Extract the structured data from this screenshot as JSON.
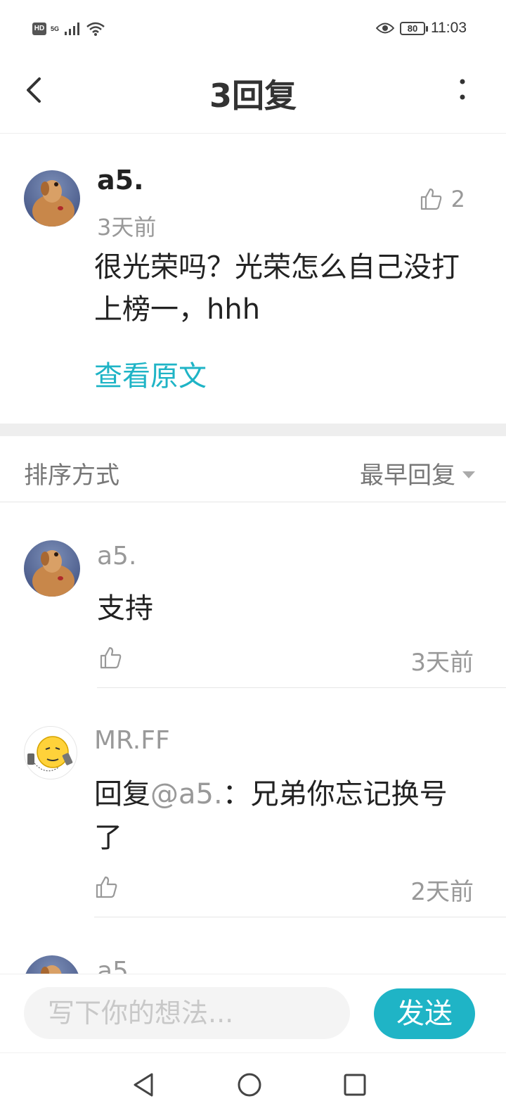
{
  "status_bar": {
    "hd": "HD",
    "network": "5G",
    "battery": "80",
    "time": "11:03",
    "icons": [
      "hd-icon",
      "signal-icon",
      "wifi-icon",
      "eye-icon",
      "battery-icon"
    ]
  },
  "header": {
    "title": "3回复",
    "back_icon": "chevron-left-icon",
    "more_icon": "more-vertical-icon"
  },
  "post": {
    "author": "a5.",
    "time": "3天前",
    "like_count": "2",
    "content": "很光荣吗？光荣怎么自己没打上榜一，hhh",
    "view_original": "查看原文"
  },
  "sort": {
    "label": "排序方式",
    "selected": "最早回复"
  },
  "replies": [
    {
      "author": "a5.",
      "mention": "",
      "prefix": "",
      "content": "支持",
      "time": "3天前"
    },
    {
      "author": "MR.FF",
      "prefix": "回复",
      "mention": "@a5.",
      "content": "：兄弟你忘记换号了",
      "time": "2天前"
    },
    {
      "author": "a5.",
      "mention": "",
      "prefix": "",
      "content": "",
      "time": ""
    }
  ],
  "composer": {
    "placeholder": "写下你的想法...",
    "send_label": "发送"
  },
  "colors": {
    "accent": "#1fb4c6",
    "muted_text": "#999999",
    "divider": "#eeeeee"
  }
}
